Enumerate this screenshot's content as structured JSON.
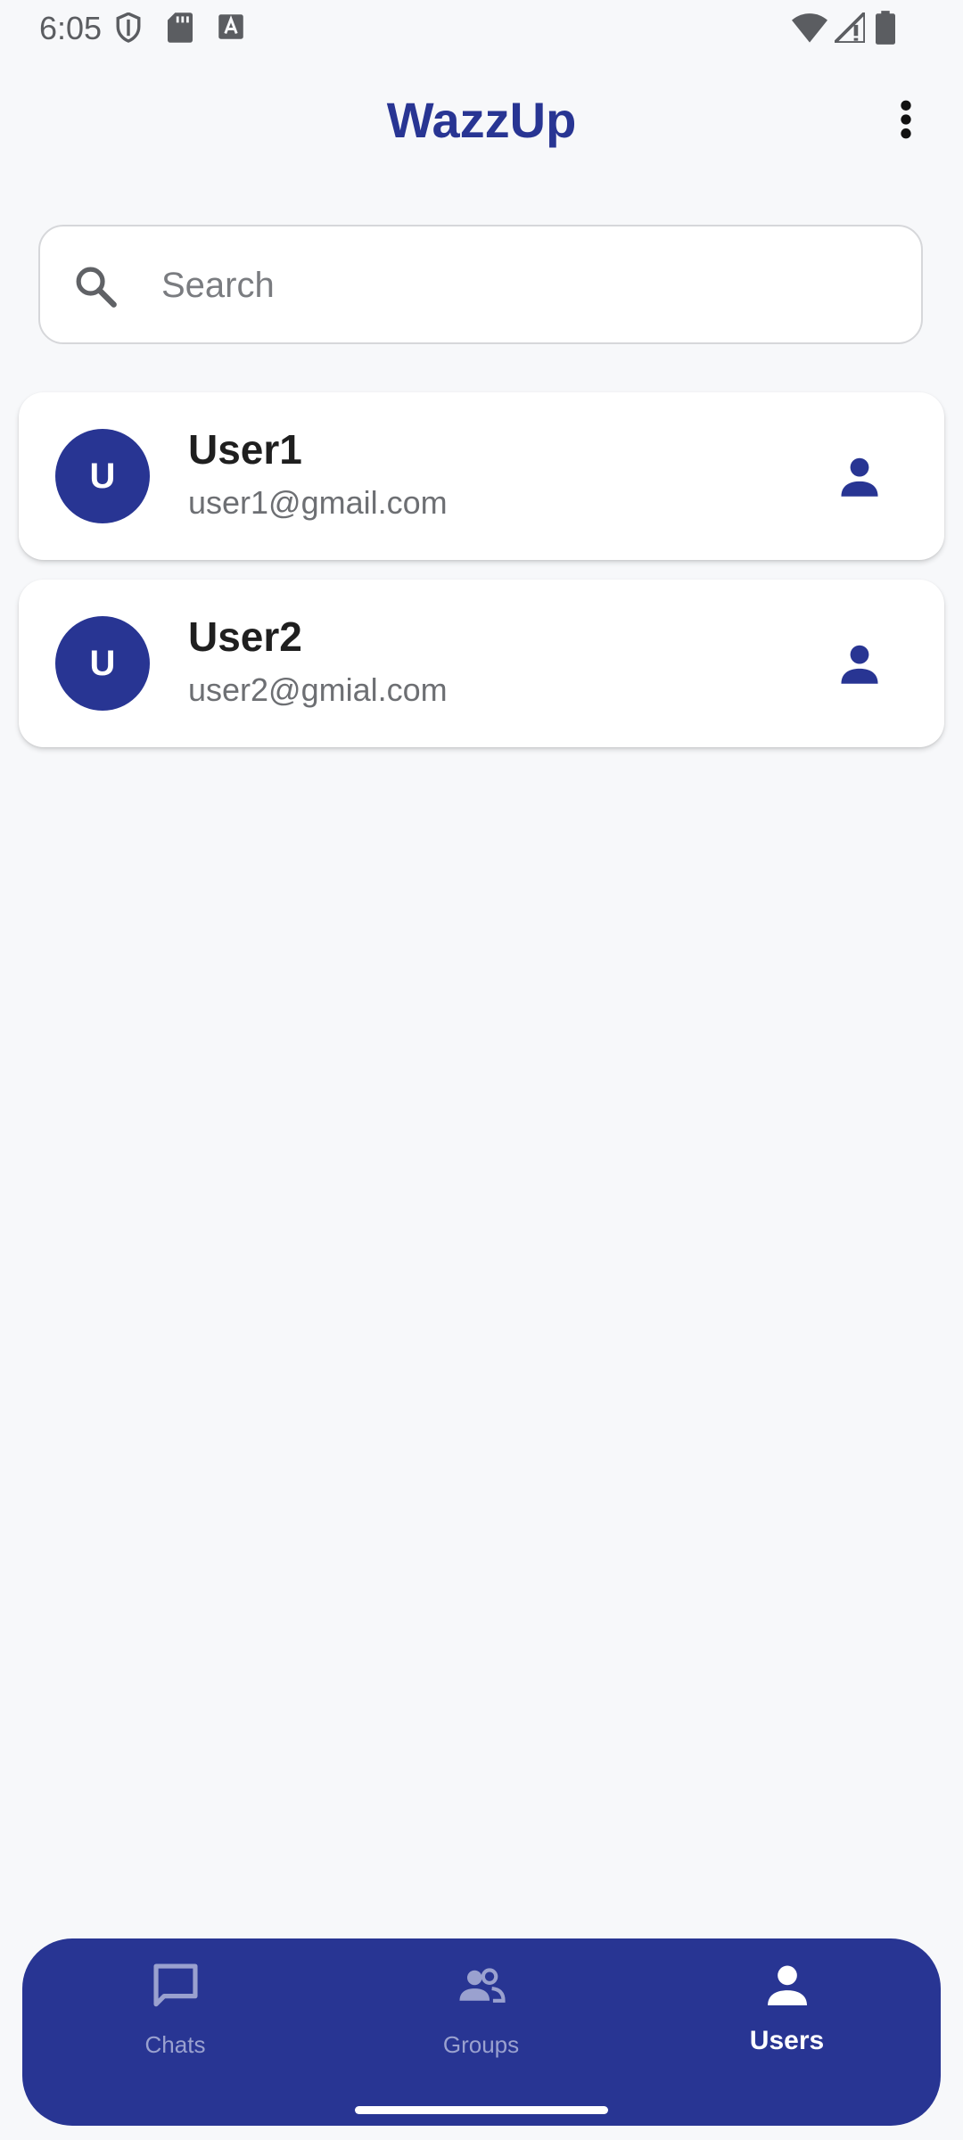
{
  "status_bar": {
    "time": "6:05",
    "left_icons": [
      "shield-icon",
      "sd-card-icon",
      "keyboard-a-icon"
    ],
    "right_icons": [
      "wifi-icon",
      "cell-signal-icon",
      "battery-icon"
    ]
  },
  "header": {
    "title": "WazzUp",
    "menu_icon": "more-vert-icon"
  },
  "search": {
    "placeholder": "Search",
    "value": "",
    "icon": "search-icon"
  },
  "users": [
    {
      "initial": "U",
      "name": "User1",
      "email": "user1@gmail.com",
      "action_icon": "person-icon"
    },
    {
      "initial": "U",
      "name": "User2",
      "email": "user2@gmial.com",
      "action_icon": "person-icon"
    }
  ],
  "bottom_nav": {
    "items": [
      {
        "label": "Chats",
        "icon": "chat-bubble-icon",
        "active": false
      },
      {
        "label": "Groups",
        "icon": "groups-icon",
        "active": false
      },
      {
        "label": "Users",
        "icon": "person-icon",
        "active": true
      }
    ]
  },
  "colors": {
    "primary": "#283593",
    "background": "#f7f8fa",
    "card": "#ffffff",
    "nav_inactive": "#9aa1cf"
  }
}
